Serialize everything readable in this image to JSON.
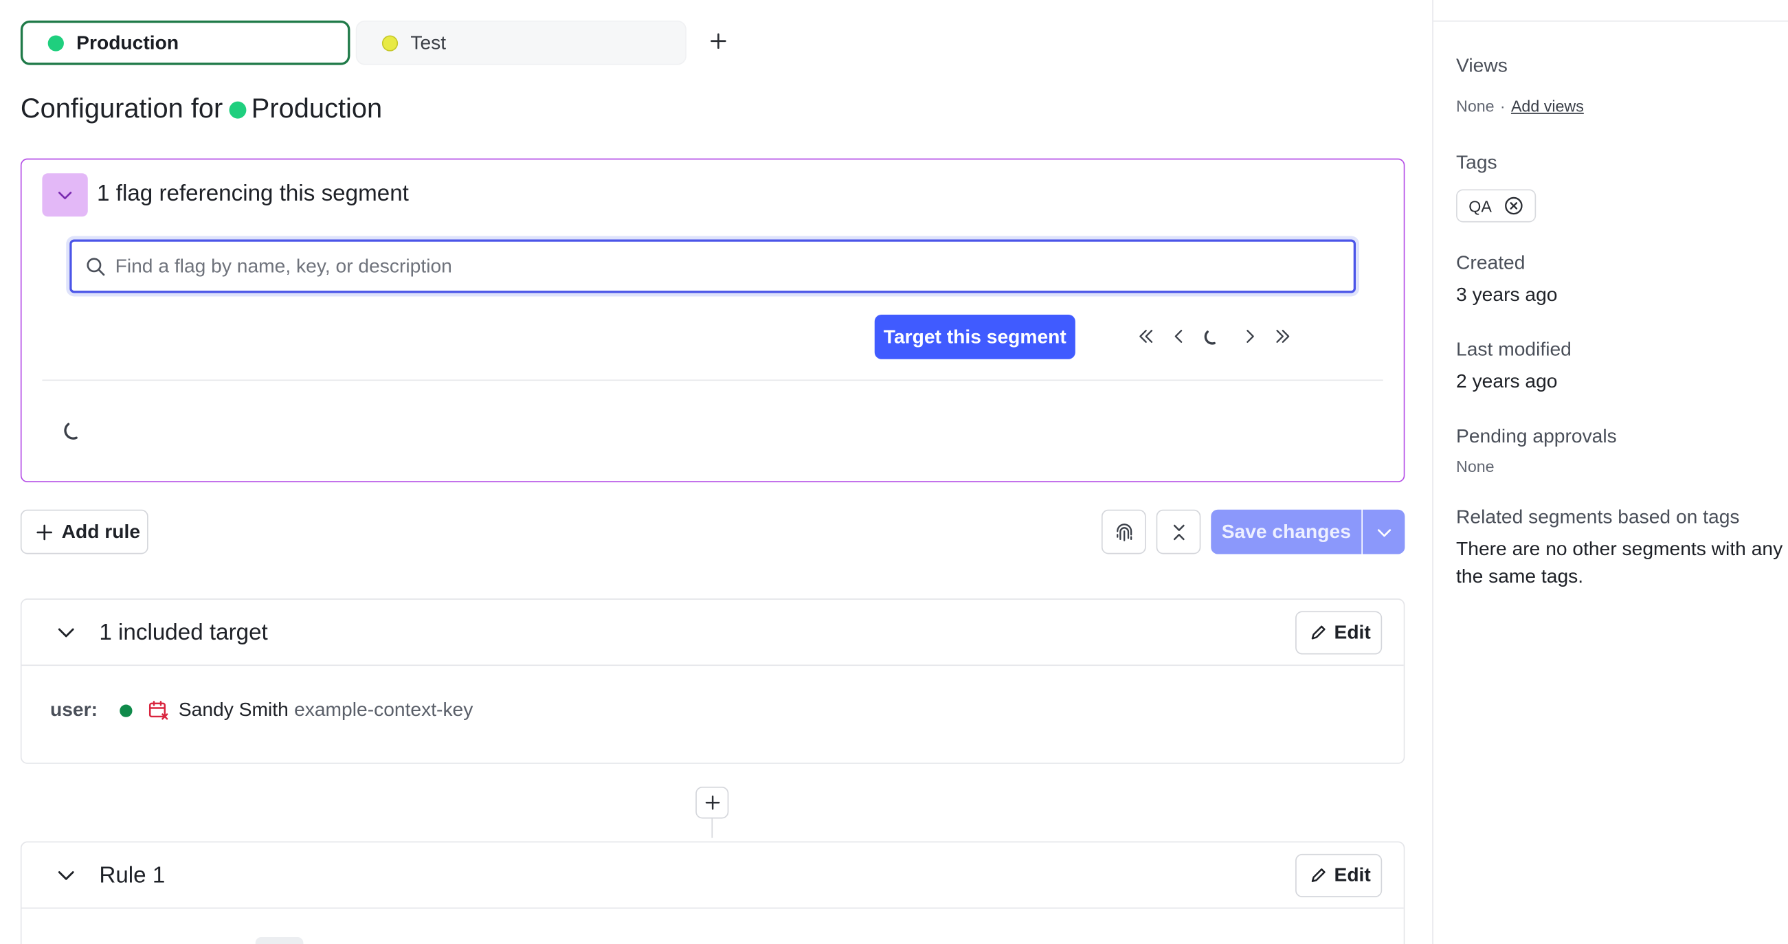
{
  "environments": {
    "tabs": [
      {
        "label": "Production",
        "color": "#1fcf7e",
        "active": true
      },
      {
        "label": "Test",
        "color": "#e8ea45",
        "active": false
      }
    ],
    "add_icon": "plus-icon"
  },
  "page": {
    "title_prefix": "Configuration for",
    "title_env": "Production"
  },
  "flags_panel": {
    "title": "1 flag referencing this segment",
    "search_placeholder": "Find a flag by name, key, or description",
    "target_button": "Target this segment",
    "pagination_icons": [
      "chevrons-left-icon",
      "chevron-left-icon",
      "loading-spinner-icon",
      "chevron-right-icon",
      "chevrons-right-icon"
    ]
  },
  "toolbar": {
    "add_rule": "Add rule",
    "fingerprint_icon": "fingerprint-icon",
    "collapse_icon": "collapse-all-icon",
    "save_label": "Save changes"
  },
  "included_targets": {
    "title": "1 included target",
    "edit_label": "Edit",
    "context_kind": "user:",
    "target_name": "Sandy Smith",
    "target_key": "example-context-key",
    "status_color": "#0f8a4a",
    "calendar_icon_color": "#d9253f"
  },
  "rule1": {
    "title": "Rule 1",
    "edit_label": "Edit"
  },
  "sidebar": {
    "views_label": "Views",
    "views_value": "None",
    "views_separator": "·",
    "add_views_link": "Add views",
    "tags_label": "Tags",
    "tags": [
      "QA"
    ],
    "created_label": "Created",
    "created_value": "3 years ago",
    "modified_label": "Last modified",
    "modified_value": "2 years ago",
    "pending_label": "Pending approvals",
    "pending_value": "None",
    "related_label": "Related segments based on tags",
    "related_line1": "There are no other segments with any of",
    "related_line2": "the same tags."
  },
  "colors": {
    "accent": "#405bff",
    "panel_border": "#b44de6",
    "save_disabled": "#8b98fb"
  }
}
